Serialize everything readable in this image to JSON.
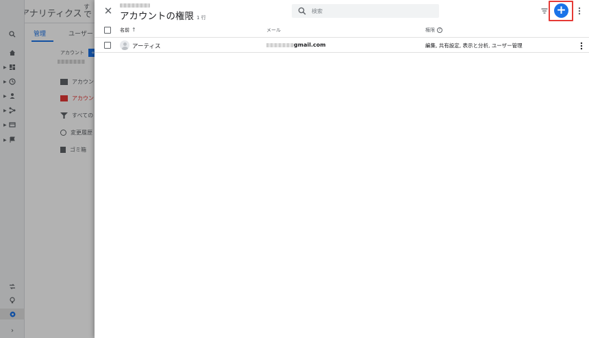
{
  "background": {
    "app_title": "アナリティクス",
    "app_title_sub_line1": "す",
    "app_title_sub_line2": "で",
    "tabs": [
      {
        "label": "管理"
      },
      {
        "label": "ユーザー"
      }
    ],
    "account_label": "アカウント",
    "create_button_label": "+ ア",
    "menu_items": [
      {
        "label": "アカウン"
      },
      {
        "label": "アカウン"
      },
      {
        "label": "すべての"
      },
      {
        "label": "変更履歴"
      },
      {
        "label": "ゴミ箱"
      }
    ]
  },
  "panel": {
    "title": "アカウントの権限",
    "row_count": "1 行",
    "close_icon": "close-icon",
    "search": {
      "placeholder": "検索"
    },
    "columns": {
      "name": "名前",
      "email": "メール",
      "permissions": "権限"
    },
    "rows": [
      {
        "name": "アーティス",
        "email_visible": "gmail.com",
        "permissions": "編集, 共有設定, 表示と分析, ユーザー管理"
      }
    ]
  },
  "colors": {
    "accent": "#1a73e8",
    "highlight": "#e53935",
    "ga_orange": "#f9ab00"
  }
}
